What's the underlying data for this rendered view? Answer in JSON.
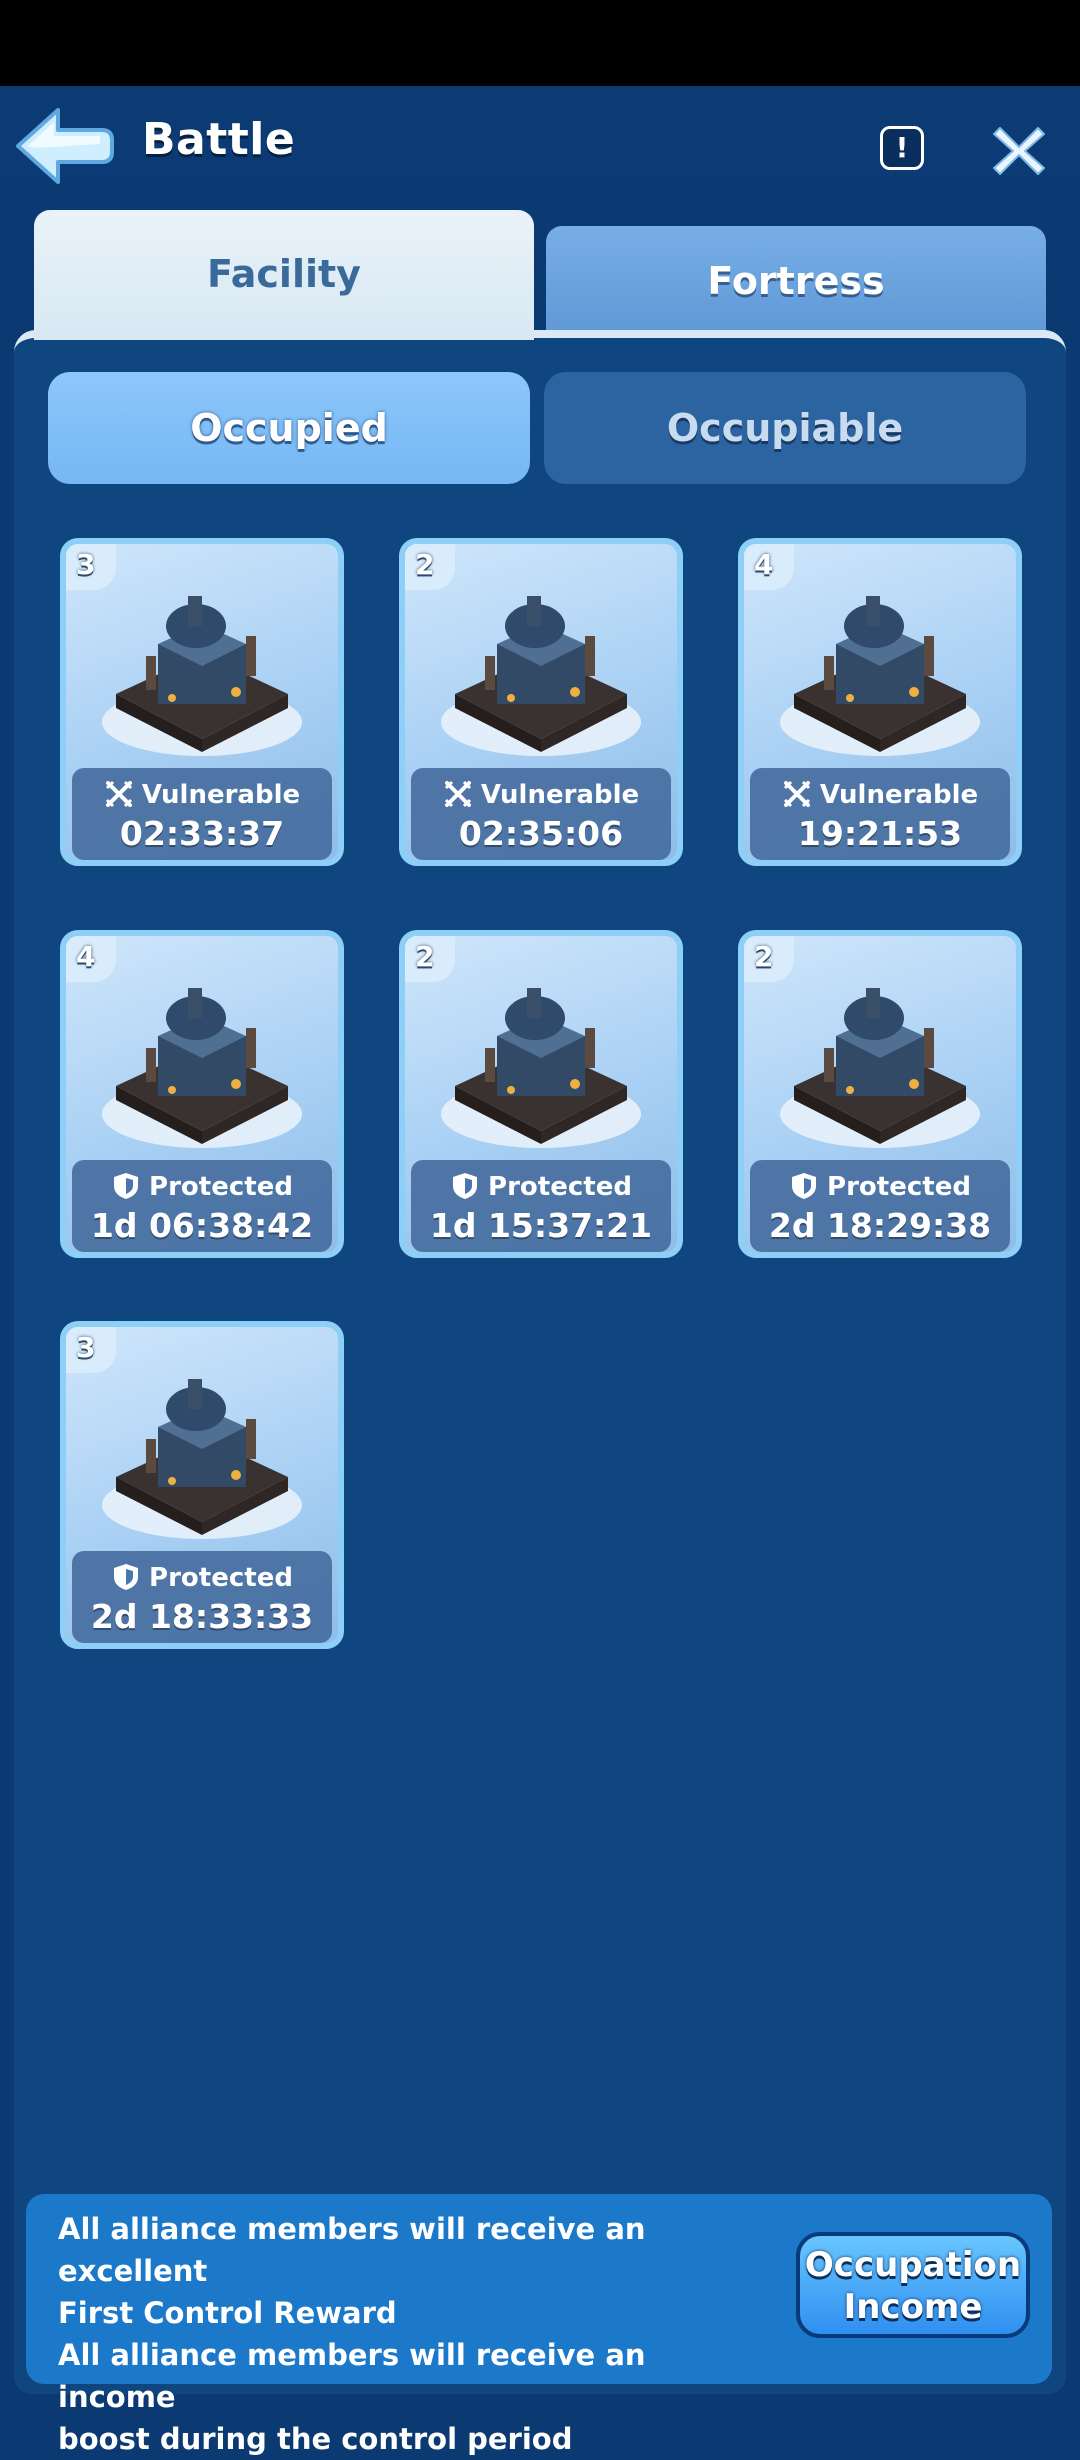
{
  "header": {
    "title": "Battle",
    "info_label": "!"
  },
  "tabs": [
    {
      "label": "Facility",
      "active": true
    },
    {
      "label": "Fortress",
      "active": false
    }
  ],
  "segments": [
    {
      "label": "Occupied",
      "active": true
    },
    {
      "label": "Occupiable",
      "active": false
    }
  ],
  "facilities": [
    {
      "level": "3",
      "status": "Vulnerable",
      "timer": "02:33:37",
      "icon": "crossed-swords-icon"
    },
    {
      "level": "2",
      "status": "Vulnerable",
      "timer": "02:35:06",
      "icon": "crossed-swords-icon"
    },
    {
      "level": "4",
      "status": "Vulnerable",
      "timer": "19:21:53",
      "icon": "crossed-swords-icon"
    },
    {
      "level": "4",
      "status": "Protected",
      "timer": "1d 06:38:42",
      "icon": "shield-icon"
    },
    {
      "level": "2",
      "status": "Protected",
      "timer": "1d 15:37:21",
      "icon": "shield-icon"
    },
    {
      "level": "2",
      "status": "Protected",
      "timer": "2d 18:29:38",
      "icon": "shield-icon"
    },
    {
      "level": "3",
      "status": "Protected",
      "timer": "2d 18:33:33",
      "icon": "shield-icon"
    }
  ],
  "footer": {
    "line1": "All alliance members will receive an excellent",
    "line2": "First Control Reward",
    "line3": "All alliance members will receive an income",
    "line4": "boost during the control period",
    "button_line1": "Occupation",
    "button_line2": "Income"
  },
  "colors": {
    "background": "#0b3a73",
    "panel": "#0f4680",
    "accent": "#76b6f2",
    "footer": "#1c78c8"
  }
}
